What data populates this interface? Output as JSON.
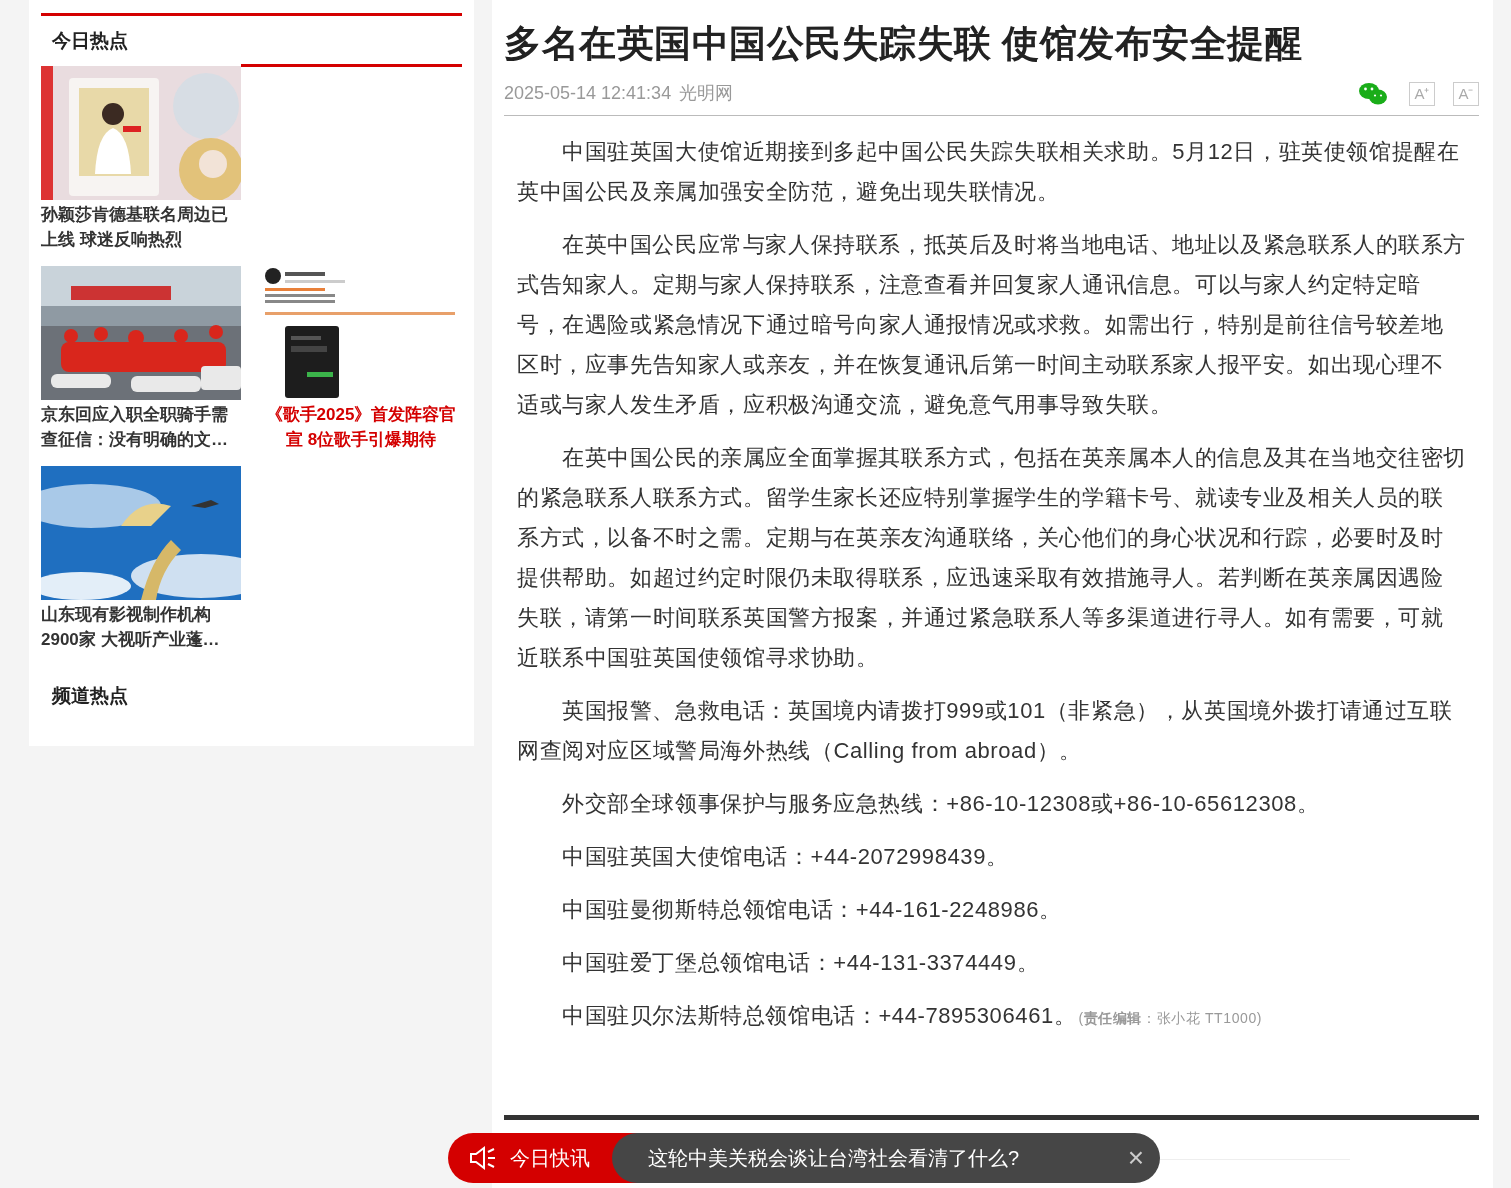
{
  "sidebar": {
    "title": "今日热点",
    "rows": [
      [
        {
          "title": "孙颖莎肯德基联名周边已上线 球迷反响热烈",
          "highlighted": false
        }
      ],
      [
        {
          "title": "京东回应入职全职骑手需查征信：没有明确的文…",
          "highlighted": false
        },
        {
          "title": "《歌手2025》首发阵容官宣 8位歌手引爆期待",
          "highlighted": true
        }
      ],
      [
        {
          "title": "山东现有影视制作机构2900家 大视听产业蓬…",
          "highlighted": false
        }
      ]
    ],
    "section_title": "频道热点"
  },
  "article": {
    "title": "多名在英国中国公民失踪失联 使馆发布安全提醒",
    "date": "2025-05-14 12:41:34",
    "source": "光明网",
    "paragraphs": [
      "中国驻英国大使馆近期接到多起中国公民失踪失联相关求助。5月12日，驻英使领馆提醒在英中国公民及亲属加强安全防范，避免出现失联情况。",
      "在英中国公民应常与家人保持联系，抵英后及时将当地电话、地址以及紧急联系人的联系方式告知家人。定期与家人保持联系，注意查看并回复家人通讯信息。可以与家人约定特定暗号，在遇险或紧急情况下通过暗号向家人通报情况或求救。如需出行，特别是前往信号较差地区时，应事先告知家人或亲友，并在恢复通讯后第一时间主动联系家人报平安。如出现心理不适或与家人发生矛盾，应积极沟通交流，避免意气用事导致失联。",
      "在英中国公民的亲属应全面掌握其联系方式，包括在英亲属本人的信息及其在当地交往密切的紧急联系人联系方式。留学生家长还应特别掌握学生的学籍卡号、就读专业及相关人员的联系方式，以备不时之需。定期与在英亲友沟通联络，关心他们的身心状况和行踪，必要时及时提供帮助。如超过约定时限仍未取得联系，应迅速采取有效措施寻人。若判断在英亲属因遇险失联，请第一时间联系英国警方报案，并通过紧急联系人等多渠道进行寻人。如有需要，可就近联系中国驻英国使领馆寻求协助。",
      "英国报警、急救电话：英国境内请拨打999或101（非紧急），从英国境外拨打请通过互联网查阅对应区域警局海外热线（Calling from abroad）。",
      "外交部全球领事保护与服务应急热线：+86-10-12308或+86-10-65612308。",
      "中国驻英国大使馆电话：+44-2072998439。",
      "中国驻曼彻斯特总领馆电话：+44-161-2248986。",
      "中国驻爱丁堡总领馆电话：+44-131-3374449。",
      "中国驻贝尔法斯特总领馆电话：+44-7895306461。"
    ],
    "editor_note": "(**责任编辑**：张小花 TT1000)",
    "font_buttons": [
      "A⁺",
      "A⁻"
    ]
  },
  "ticker": {
    "label": "今日快讯",
    "headline": "这轮中美关税会谈让台湾社会看清了什么?",
    "close": "×"
  }
}
